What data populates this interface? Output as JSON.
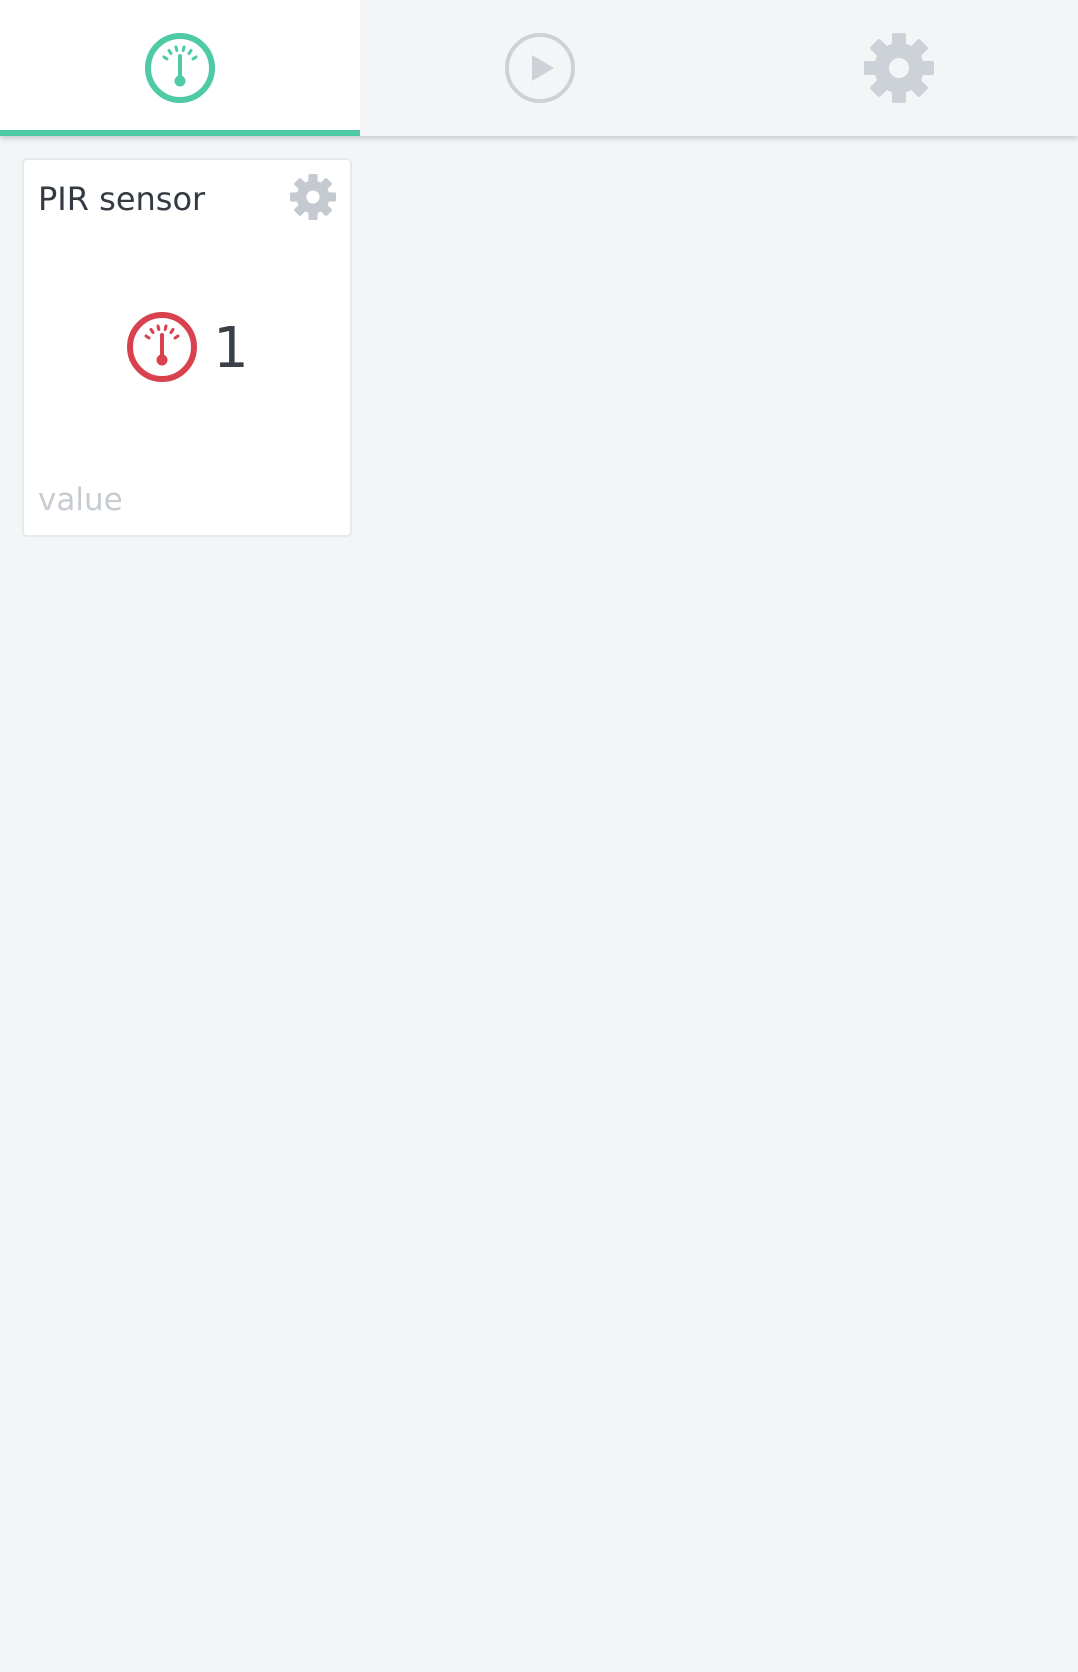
{
  "tabs": [
    {
      "icon": "gauge-icon",
      "active": true,
      "color": "#4fcaa6"
    },
    {
      "icon": "play-icon",
      "active": false,
      "color": "#cdd2d8"
    },
    {
      "icon": "gear-icon",
      "active": false,
      "color": "#cdd2d8"
    }
  ],
  "card": {
    "title": "PIR sensor",
    "value": "1",
    "caption": "value",
    "icon": "gauge-icon",
    "icon_color": "#d9414e",
    "settings_icon": "gear-icon",
    "settings_color": "#c5cad0"
  }
}
